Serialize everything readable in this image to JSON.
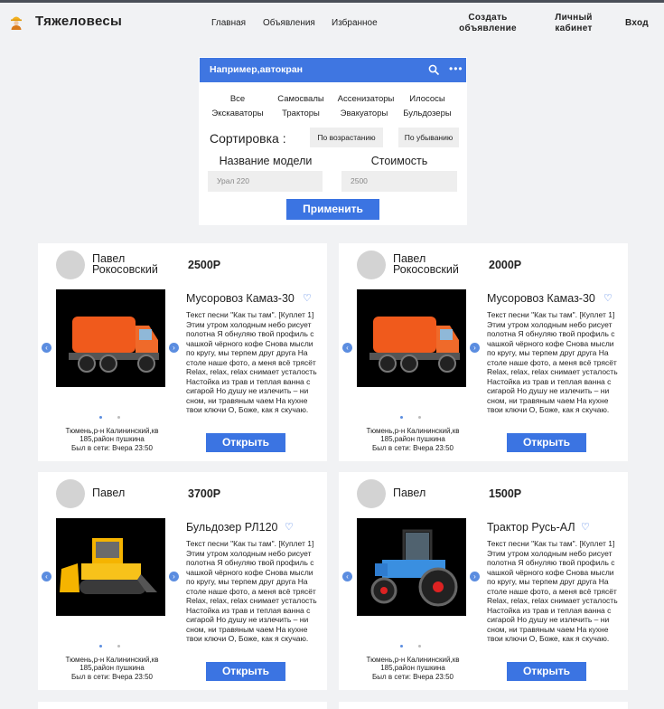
{
  "header": {
    "logo": "Тяжеловесы",
    "nav": [
      "Главная",
      "Объявления",
      "Избранное"
    ],
    "create_ad": [
      "Создать",
      "объявление"
    ],
    "cabinet": [
      "Личный",
      "кабинет"
    ],
    "login": "Вход"
  },
  "search": {
    "placeholder": "Например,автокран",
    "categories": [
      "Все",
      "Самосвалы",
      "Ассенизаторы",
      "Илососы",
      "Экскаваторы",
      "Тракторы",
      "Эвакуаторы",
      "Бульдозеры"
    ],
    "sort_label": "Сортировка :",
    "sort_asc": "По возрастанию",
    "sort_desc": "По убыванию",
    "model_label": "Название модели",
    "price_label": "Стоимость",
    "model_value": "Урал 220",
    "price_value": "2500",
    "apply": "Применить"
  },
  "listings": [
    {
      "seller": "Павел Рокосовский",
      "price": "2500Р",
      "model": "Мусоровоз Камаз-30",
      "photo": "garbage-truck",
      "description": "Текст песни \"Как ты там\". [Куплет 1] Этим утром холодным небо рисует полотна Я обнуляю твой профиль с чашкой чёрного кофе Снова мысли по кругу, мы терпем друг друга На столе наше фото, а меня всё трясёт Relax, relax, relax снимает усталость Настойка из трав и теплая ванна с сигарой Но душу не излечить – ни сном, ни травяным чаем На кухне твои ключи О, Боже, как я скучаю.",
      "location": "Тюмень,р-н Калининский,кв 185,район пушкина",
      "online": "Был в сети: Вчера 23:50",
      "open": "Открыть"
    },
    {
      "seller": "Павел Рокосовский",
      "price": "2000Р",
      "model": "Мусоровоз Камаз-30",
      "photo": "garbage-truck",
      "description": "Текст песни \"Как ты там\". [Куплет 1] Этим утром холодным небо рисует полотна Я обнуляю твой профиль с чашкой чёрного кофе Снова мысли по кругу, мы терпем друг друга На столе наше фото, а меня всё трясёт Relax, relax, relax снимает усталость Настойка из трав и теплая ванна с сигарой Но душу не излечить – ни сном, ни травяным чаем На кухне твои ключи О, Боже, как я скучаю.",
      "location": "Тюмень,р-н Калининский,кв 185,район пушкина",
      "online": "Был в сети: Вчера 23:50",
      "open": "Открыть"
    },
    {
      "seller": "Павел",
      "price": "3700Р",
      "model": "Бульдозер РЛ120",
      "photo": "bulldozer",
      "description": "Текст песни \"Как ты там\". [Куплет 1] Этим утром холодным небо рисует полотна Я обнуляю твой профиль с чашкой чёрного кофе Снова мысли по кругу, мы терпем друг друга На столе наше фото, а меня всё трясёт Relax, relax, relax снимает усталость Настойка из трав и теплая ванна с сигарой Но душу не излечить – ни сном, ни травяным чаем На кухне твои ключи О, Боже, как я скучаю.",
      "location": "Тюмень,р-н Калининский,кв 185,район пушкина",
      "online": "Был в сети: Вчера 23:50",
      "open": "Открыть"
    },
    {
      "seller": "Павел",
      "price": "1500Р",
      "model": "Трактор Русь-АЛ",
      "photo": "tractor",
      "description": "Текст песни \"Как ты там\". [Куплет 1] Этим утром холодным небо рисует полотна Я обнуляю твой профиль с чашкой чёрного кофе Снова мысли по кругу, мы терпем друг друга На столе наше фото, а меня всё трясёт Relax, relax, relax снимает усталость Настойка из трав и теплая ванна с сигарой Но душу не излечить – ни сном, ни травяным чаем На кухне твои ключи О, Боже, как я скучаю.",
      "location": "Тюмень,р-н Калининский,кв 185,район пушкина",
      "online": "Был в сети: Вчера 23:50",
      "open": "Открыть"
    }
  ],
  "colors": {
    "accent": "#3b74e2",
    "search_bar": "#3f76e1",
    "background": "#f1f2f4"
  }
}
